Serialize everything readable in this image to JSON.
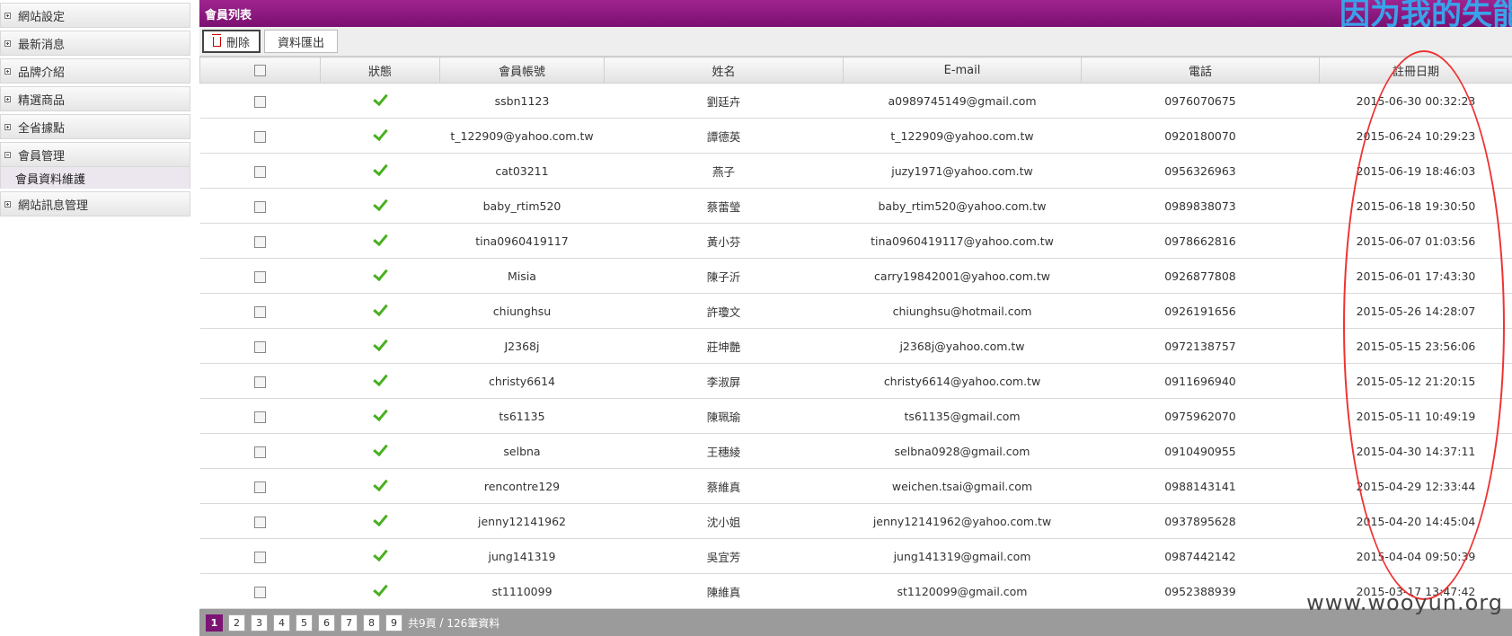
{
  "sidebar": {
    "items": [
      {
        "label": "網站設定",
        "expanded": false
      },
      {
        "label": "最新消息",
        "expanded": false
      },
      {
        "label": "品牌介紹",
        "expanded": false
      },
      {
        "label": "精選商品",
        "expanded": false
      },
      {
        "label": "全省據點",
        "expanded": false
      },
      {
        "label": "會員管理",
        "expanded": true,
        "sub": "會員資料維護"
      },
      {
        "label": "網站訊息管理",
        "expanded": false
      }
    ]
  },
  "panel": {
    "title": "會員列表",
    "overlay": "因为我的失能",
    "toolbar": {
      "delete_label": "刪除",
      "export_label": "資料匯出"
    }
  },
  "table": {
    "headers": [
      "",
      "狀態",
      "會員帳號",
      "姓名",
      "E-mail",
      "電話",
      "註冊日期"
    ],
    "rows": [
      [
        "ssbn1123",
        "劉廷卉",
        "a0989745149@gmail.com",
        "0976070675",
        "2015-06-30 00:32:23"
      ],
      [
        "t_122909@yahoo.com.tw",
        "譚德英",
        "t_122909@yahoo.com.tw",
        "0920180070",
        "2015-06-24 10:29:23"
      ],
      [
        "cat03211",
        "燕子",
        "juzy1971@yahoo.com.tw",
        "0956326963",
        "2015-06-19 18:46:03"
      ],
      [
        "baby_rtim520",
        "蔡蕾瑩",
        "baby_rtim520@yahoo.com.tw",
        "0989838073",
        "2015-06-18 19:30:50"
      ],
      [
        "tina0960419117",
        "黃小芬",
        "tina0960419117@yahoo.com.tw",
        "0978662816",
        "2015-06-07 01:03:56"
      ],
      [
        "Misia",
        "陳子沂",
        "carry19842001@yahoo.com.tw",
        "0926877808",
        "2015-06-01 17:43:30"
      ],
      [
        "chiunghsu",
        "許瓊文",
        "chiunghsu@hotmail.com",
        "0926191656",
        "2015-05-26 14:28:07"
      ],
      [
        "J2368j",
        "莊坤艷",
        "j2368j@yahoo.com.tw",
        "0972138757",
        "2015-05-15 23:56:06"
      ],
      [
        "christy6614",
        "李淑屏",
        "christy6614@yahoo.com.tw",
        "0911696940",
        "2015-05-12 21:20:15"
      ],
      [
        "ts61135",
        "陳珮瑜",
        "ts61135@gmail.com",
        "0975962070",
        "2015-05-11 10:49:19"
      ],
      [
        "selbna",
        "王穗綾",
        "selbna0928@gmail.com",
        "0910490955",
        "2015-04-30 14:37:11"
      ],
      [
        "rencontre129",
        "蔡維真",
        "weichen.tsai@gmail.com",
        "0988143141",
        "2015-04-29 12:33:44"
      ],
      [
        "jenny12141962",
        "沈小姐",
        "jenny12141962@yahoo.com.tw",
        "0937895628",
        "2015-04-20 14:45:04"
      ],
      [
        "jung141319",
        "吳宜芳",
        "jung141319@gmail.com",
        "0987442142",
        "2015-04-04 09:50:39"
      ],
      [
        "st1110099",
        "陳維真",
        "st1120099@gmail.com",
        "0952388939",
        "2015-03-17 13:47:42"
      ]
    ]
  },
  "pager": {
    "pages": [
      "1",
      "2",
      "3",
      "4",
      "5",
      "6",
      "7",
      "8",
      "9"
    ],
    "current": "1",
    "summary_pages": "共9頁",
    "separator": " / ",
    "summary_records": "126筆資料"
  },
  "watermark": "www.wooyun.org",
  "colors": {
    "accent": "#8a1a80",
    "check": "#48b020",
    "annotation": "#e33333"
  }
}
